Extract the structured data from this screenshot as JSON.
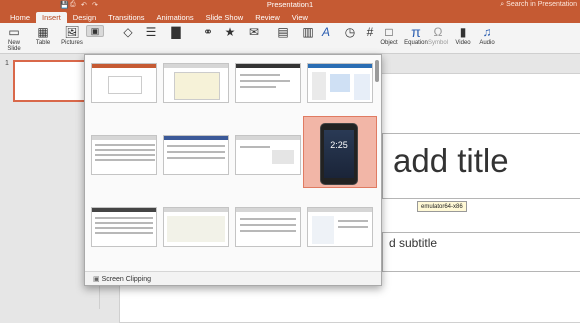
{
  "window": {
    "title": "Presentation1",
    "search_placeholder": "Search in Presentation"
  },
  "quick_access": {
    "save_icon": "save-icon",
    "undo_icon": "undo-icon",
    "redo_icon": "redo-icon",
    "print_icon": "print-icon"
  },
  "tabs": [
    {
      "label": "Home"
    },
    {
      "label": "Insert"
    },
    {
      "label": "Design"
    },
    {
      "label": "Transitions"
    },
    {
      "label": "Animations"
    },
    {
      "label": "Slide Show"
    },
    {
      "label": "Review"
    },
    {
      "label": "View"
    }
  ],
  "ribbon": {
    "new_slide": "New\nSlide",
    "table": "Table",
    "pictures": "Pictures",
    "screenshot_short": "S",
    "object": "Object",
    "equation": "Equation",
    "symbol": "Symbol",
    "video": "Video",
    "audio": "Audio"
  },
  "sidebar": {
    "slide_number": "1"
  },
  "slide": {
    "title_placeholder": "add title",
    "subtitle_placeholder": "d subtitle"
  },
  "tooltip": "emulator64-x86",
  "gallery": {
    "footer_label": "Screen Clipping",
    "footer_icon": "screen-clipping-icon",
    "selected_clock": "2:25"
  },
  "colors": {
    "accent": "#c55a33",
    "selected": "#f2b6a7"
  }
}
